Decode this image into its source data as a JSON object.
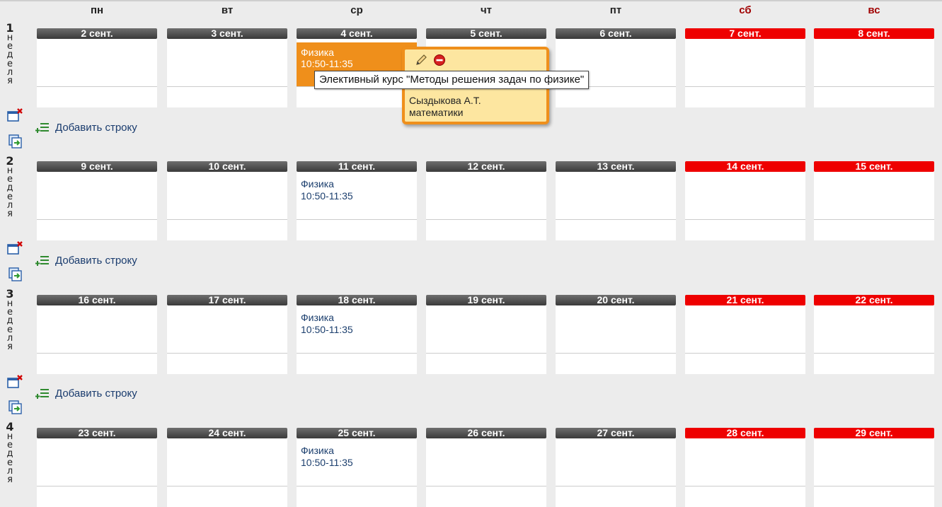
{
  "day_names": [
    "пн",
    "вт",
    "ср",
    "чт",
    "пт",
    "сб",
    "вс"
  ],
  "weeks": [
    {
      "number": "1",
      "word": "неделя",
      "dates": [
        "2 сент.",
        "3 сент.",
        "4 сент.",
        "5 сент.",
        "6 сент.",
        "7 сент.",
        "8 сент."
      ],
      "add_row_label": "Добавить строку"
    },
    {
      "number": "2",
      "word": "неделя",
      "dates": [
        "9 сент.",
        "10 сент.",
        "11 сент.",
        "12 сент.",
        "13 сент.",
        "14 сент.",
        "15 сент."
      ],
      "add_row_label": "Добавить строку",
      "lesson": {
        "subject": "Физика",
        "time": "10:50-11:35"
      }
    },
    {
      "number": "3",
      "word": "неделя",
      "dates": [
        "16 сент.",
        "17 сент.",
        "18 сент.",
        "19 сент.",
        "20 сент.",
        "21 сент.",
        "22 сент."
      ],
      "add_row_label": "Добавить строку",
      "lesson": {
        "subject": "Физика",
        "time": "10:50-11:35"
      }
    },
    {
      "number": "4",
      "word": "неделя",
      "dates": [
        "23 сент.",
        "24 сент.",
        "25 сент.",
        "26 сент.",
        "27 сент.",
        "28 сент.",
        "29 сент."
      ],
      "lesson": {
        "subject": "Физика",
        "time": "10:50-11:35"
      }
    }
  ],
  "active_lesson": {
    "subject": "Физика",
    "time": "10:50-11:35"
  },
  "popup": {
    "teacher": "Сыздыкова А.Т.",
    "room": "математики",
    "edit_icon": "pencil-icon",
    "delete_icon": "delete-icon"
  },
  "tooltip": "Элективный курс \"Методы решения задач по физике\"",
  "icons": {
    "clear_week": "clear-week-icon",
    "copy_week": "copy-week-icon",
    "add_row": "add-row-icon"
  },
  "colors": {
    "weekday_header": "#4a4a4a",
    "weekend_header": "#ee0000",
    "weekend_dayname": "#a00000",
    "active_lesson": "#ef8f1b",
    "popup_bg": "#fde6a0",
    "link": "#1a3c6e"
  }
}
